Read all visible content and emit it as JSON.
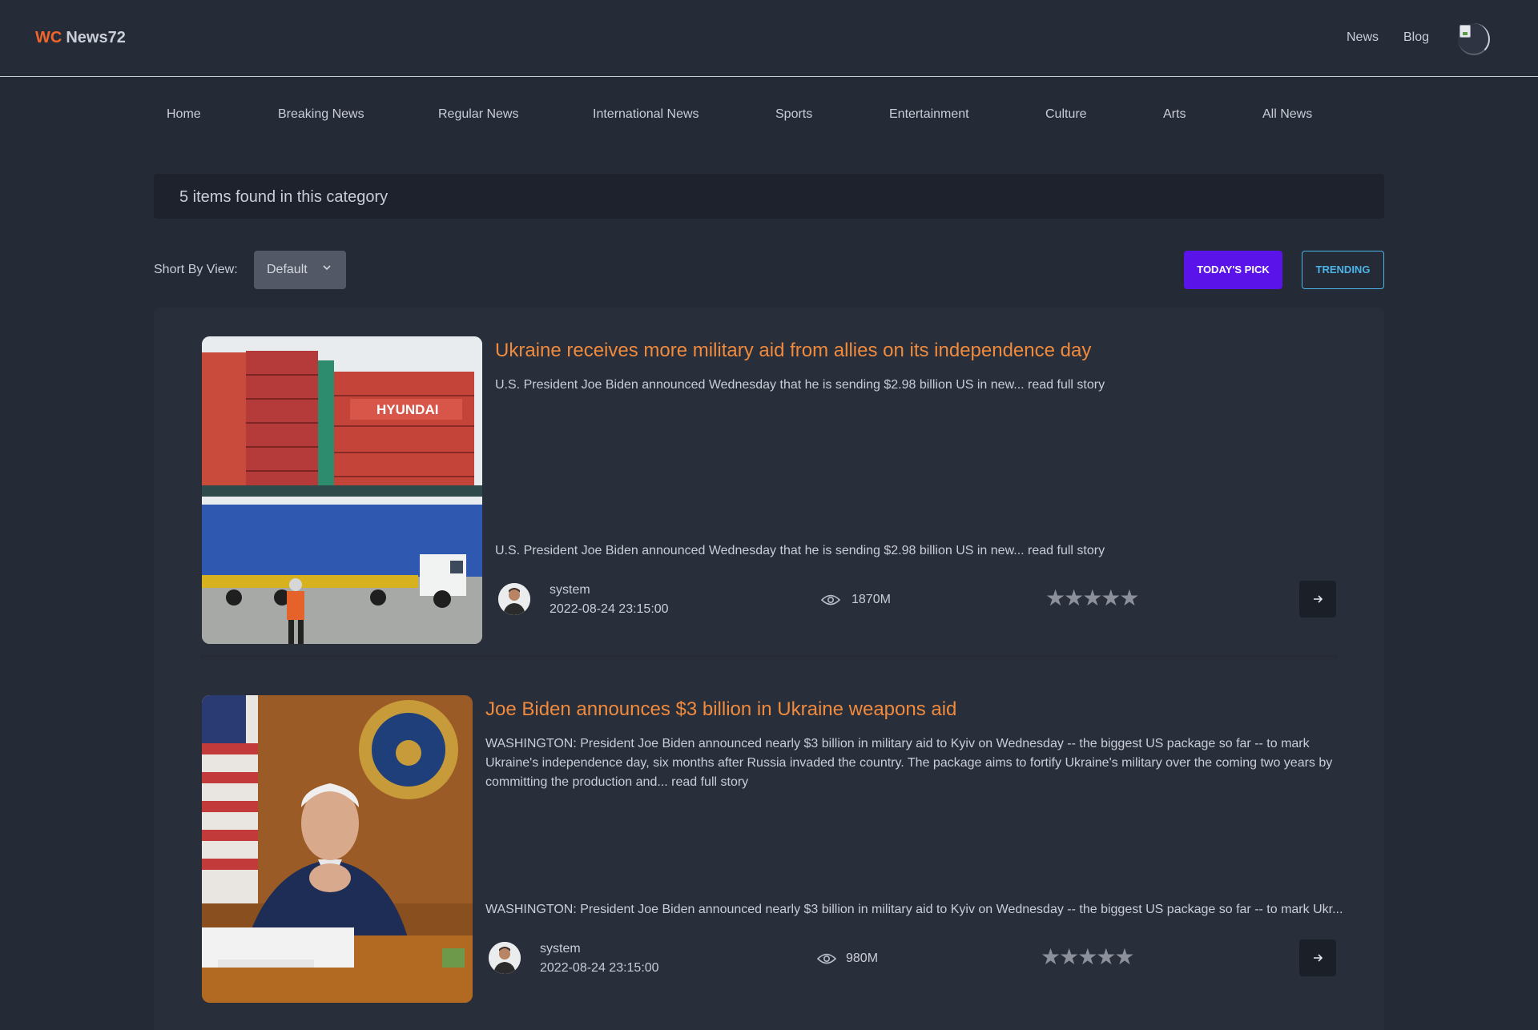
{
  "header": {
    "logo_prefix": "WC",
    "logo_name": "News72",
    "nav": [
      "News",
      "Blog"
    ]
  },
  "categories": [
    "Home",
    "Breaking News",
    "Regular News",
    "International News",
    "Sports",
    "Entertainment",
    "Culture",
    "Arts",
    "All News"
  ],
  "results": {
    "count_text": "5 items found in this category"
  },
  "sort": {
    "label": "Short By View:",
    "value": "Default"
  },
  "filters": {
    "todays_pick": "TODAY'S PICK",
    "trending": "TRENDING"
  },
  "articles": [
    {
      "title": "Ukraine receives more military aid from allies on its independence day",
      "summary": "U.S. President Joe Biden announced Wednesday that he is sending $2.98 billion US in new... read full story",
      "excerpt": "U.S. President Joe Biden announced Wednesday that he is sending $2.98 billion US in new... read full story",
      "author": "system",
      "date": "2022-08-24 23:15:00",
      "views": "1870M",
      "stars": "★★★★★",
      "image_text": "HYUNDAI"
    },
    {
      "title": "Joe Biden announces $3 billion in Ukraine weapons aid",
      "summary": "WASHINGTON: President Joe Biden announced nearly $3 billion in military aid to Kyiv on Wednesday -- the biggest US package so far -- to mark Ukraine's independence day, six months after Russia invaded the country. The package aims to fortify Ukraine's military over the coming two years by committing the production and... read full story",
      "excerpt": "WASHINGTON: President Joe Biden announced nearly $3 billion in military aid to Kyiv on Wednesday -- the biggest US package so far -- to mark Ukr...",
      "author": "system",
      "date": "2022-08-24 23:15:00",
      "views": "980M",
      "stars": "★★★★★"
    }
  ],
  "colors": {
    "accent": "#f0652a",
    "title": "#f08a3c",
    "primary_button": "#5a13e8",
    "outline_button": "#4cb3e6",
    "background": "#252a37"
  },
  "icons": [
    "chevron-down-icon",
    "eye-icon",
    "arrow-right-icon",
    "star-icon"
  ]
}
